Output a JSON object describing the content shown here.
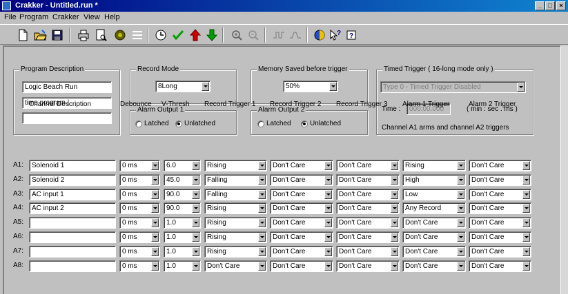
{
  "window": {
    "title": "Crakker - Untitled.run *",
    "controls": [
      "_",
      "□",
      "×"
    ]
  },
  "menu": [
    "File",
    "Program",
    "Crakker",
    "View",
    "Help"
  ],
  "toolbar": [
    {
      "name": "new-icon"
    },
    {
      "name": "open-icon"
    },
    {
      "name": "save-icon"
    },
    {
      "name": "print-icon"
    },
    {
      "name": "print-preview-icon"
    },
    {
      "name": "chip-icon"
    },
    {
      "name": "list-icon"
    },
    {
      "name": "clock-icon"
    },
    {
      "name": "check-icon"
    },
    {
      "name": "upload-icon"
    },
    {
      "name": "download-icon"
    },
    {
      "name": "zoom-in-icon"
    },
    {
      "name": "zoom-out-icon"
    },
    {
      "name": "waveform-icon"
    },
    {
      "name": "waveform-2-icon"
    },
    {
      "name": "globe-icon"
    },
    {
      "name": "context-help-icon"
    },
    {
      "name": "about-icon"
    }
  ],
  "program_description": {
    "label": "Program Description",
    "name": "Logic Beach Run",
    "line2": "time program |",
    "line3": ""
  },
  "record_mode": {
    "label": "Record Mode",
    "value": "8Long"
  },
  "memory_saved": {
    "label": "Memory Saved before trigger",
    "value": "50%"
  },
  "timed_trigger": {
    "label": "Timed Trigger ( 16-long mode only )",
    "type_value": "Type 0 - Timed Trigger Disabled",
    "time_label": "Time :",
    "time_value": "000:00.000",
    "time_units": "( min : sec . ms )",
    "note": "Channel A1 arms and channel A2 triggers"
  },
  "alarm_output_1": {
    "label": "Alarm Output 1",
    "latched": "Latched",
    "unlatched": "Unlatched"
  },
  "alarm_output_2": {
    "label": "Alarm Output 2",
    "latched": "Latched",
    "unlatched": "Unlatched"
  },
  "table": {
    "headers": {
      "desc": "Channel Description",
      "debounce": "Debounce",
      "vthresh": "V-Thresh",
      "rt1": "Record Trigger 1",
      "rt2": "Record Trigger 2",
      "rt3": "Record Trigger 3",
      "at1": "Alarm 1 Trigger",
      "at2": "Alarm 2 Trigger"
    },
    "rows": [
      {
        "ch": "A1:",
        "desc": "Solenoid 1",
        "deb": "0 ms",
        "vt": "6.0",
        "rt1": "Rising",
        "rt2": "Don't Care",
        "rt3": "Don't Care",
        "at1": "Rising",
        "at2": "Don't Care"
      },
      {
        "ch": "A2:",
        "desc": "Solenoid 2",
        "deb": "0 ms",
        "vt": "45.0",
        "rt1": "Falling",
        "rt2": "Don't Care",
        "rt3": "Don't Care",
        "at1": "High",
        "at2": "Don't Care"
      },
      {
        "ch": "A3:",
        "desc": "AC input 1",
        "deb": "0 ms",
        "vt": "90.0",
        "rt1": "Falling",
        "rt2": "Don't Care",
        "rt3": "Don't Care",
        "at1": "Low",
        "at2": "Don't Care"
      },
      {
        "ch": "A4:",
        "desc": "AC input 2",
        "deb": "0 ms",
        "vt": "90.0",
        "rt1": "Rising",
        "rt2": "Don't Care",
        "rt3": "Don't Care",
        "at1": "Any Record",
        "at2": "Don't Care"
      },
      {
        "ch": "A5:",
        "desc": "",
        "deb": "0 ms",
        "vt": "1.0",
        "rt1": "Rising",
        "rt2": "Don't Care",
        "rt3": "Don't Care",
        "at1": "Don't Care",
        "at2": "Don't Care"
      },
      {
        "ch": "A6:",
        "desc": "",
        "deb": "0 ms",
        "vt": "1.0",
        "rt1": "Rising",
        "rt2": "Don't Care",
        "rt3": "Don't Care",
        "at1": "Don't Care",
        "at2": "Don't Care"
      },
      {
        "ch": "A7:",
        "desc": "",
        "deb": "0 ms",
        "vt": "1.0",
        "rt1": "Rising",
        "rt2": "Don't Care",
        "rt3": "Don't Care",
        "at1": "Don't Care",
        "at2": "Don't Care"
      },
      {
        "ch": "A8:",
        "desc": "",
        "deb": "0 ms",
        "vt": "1.0",
        "rt1": "Don't Care",
        "rt2": "Don't Care",
        "rt3": "Don't Care",
        "at1": "Don't Care",
        "at2": "Don't Care"
      }
    ]
  }
}
